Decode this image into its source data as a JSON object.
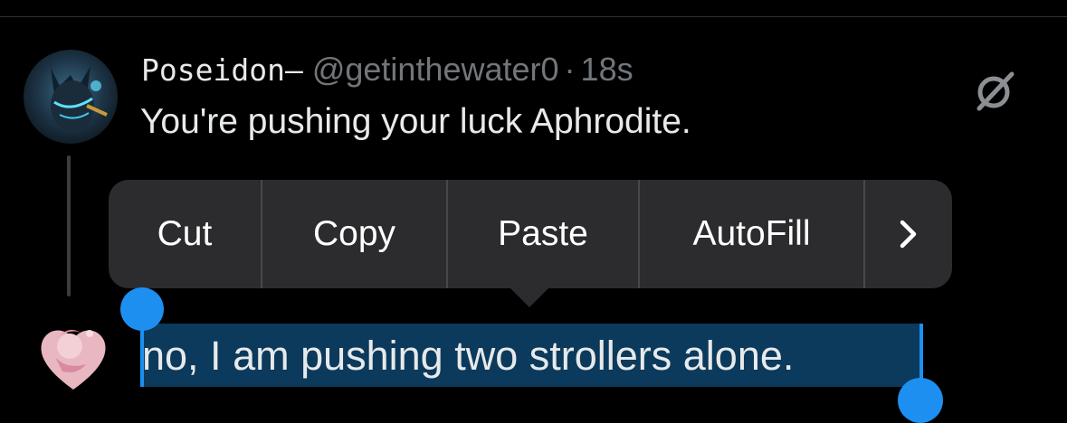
{
  "tweet": {
    "display_name": "Poseidon—",
    "handle": "@getinthewater0",
    "separator": "·",
    "timestamp": "18s",
    "text": "You're pushing your luck Aphrodite.",
    "avatar_icon": "poseidon-avatar",
    "grok_icon": "grok-icon"
  },
  "context_menu": {
    "items": [
      "Cut",
      "Copy",
      "Paste",
      "AutoFill"
    ],
    "more": "›"
  },
  "reply": {
    "text": "no, I am pushing two strollers alone.",
    "avatar_icon": "aphrodite-avatar",
    "selection_color": "#0b3a5c",
    "handle_color": "#1d8ff0"
  }
}
